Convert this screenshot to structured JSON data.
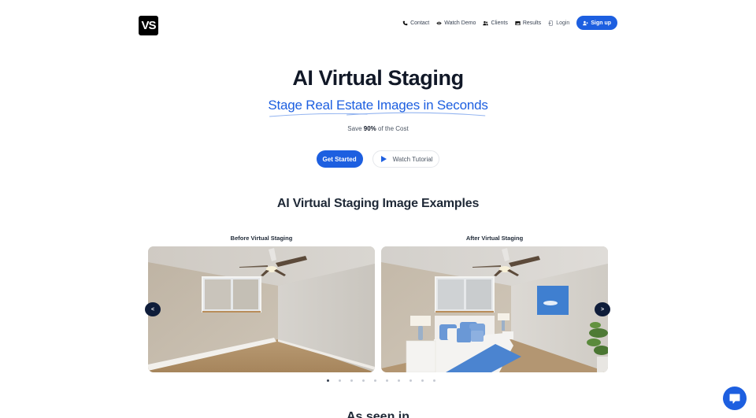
{
  "header": {
    "logo_text": "VS",
    "nav": [
      {
        "label": "Contact",
        "icon": "phone-icon"
      },
      {
        "label": "Watch Demo",
        "icon": "eye-icon"
      },
      {
        "label": "Clients",
        "icon": "users-icon"
      },
      {
        "label": "Results",
        "icon": "image-icon"
      },
      {
        "label": "Login",
        "icon": "login-icon"
      }
    ],
    "signup_label": "Sign up",
    "signup_icon": "user-plus-icon"
  },
  "hero": {
    "title": "AI Virtual Staging",
    "subtitle": "Stage Real Estate Images in Seconds",
    "note_prefix": "Save ",
    "note_bold": "90%",
    "note_suffix": " of the Cost",
    "primary_cta": "Get Started",
    "secondary_cta": "Watch Tutorial"
  },
  "examples": {
    "title": "AI Virtual Staging Image Examples",
    "before_label": "Before Virtual Staging",
    "after_label": "After Virtual Staging",
    "prev_label": "<",
    "next_label": ">",
    "slide_count": 10,
    "active_slide": 1
  },
  "as_seen_in": "As seen in",
  "colors": {
    "brand": "#1d5fe0",
    "dark_navy": "#0f1d3a",
    "text": "#111827"
  }
}
